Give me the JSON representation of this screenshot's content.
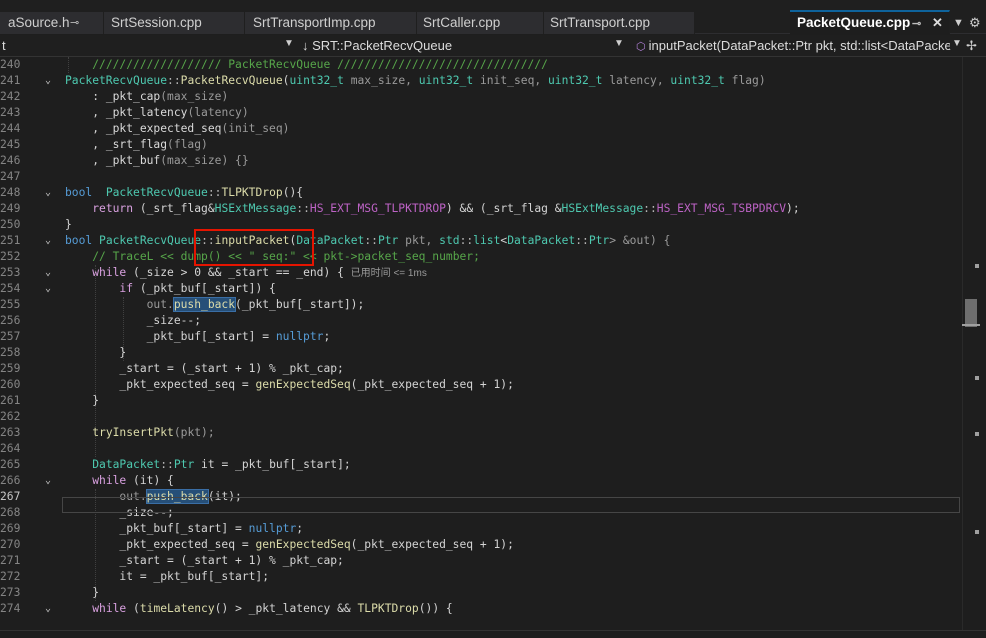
{
  "tabs": [
    {
      "label": "aSource.h",
      "pinned": true
    },
    {
      "label": "SrtSession.cpp"
    },
    {
      "label": "SrtTransportImp.cpp"
    },
    {
      "label": "SrtCaller.cpp"
    },
    {
      "label": "SrtTransport.cpp"
    },
    {
      "label": "PacketQueue.cpp",
      "active": true
    }
  ],
  "navbar": {
    "project": "t",
    "scope": "SRT::PacketRecvQueue",
    "member": "inputPacket(DataPacket::Ptr pkt, std::list<DataPacke"
  },
  "editor": {
    "current_line": "267",
    "inline_hint": "已用时间 <= 1ms"
  },
  "code_lines": [
    {
      "n": "240",
      "fold": "",
      "c": [
        {
          "t": "    ",
          "k": ""
        },
        {
          "t": "/////////////////// PacketRecvQueue ///////////////////////////////",
          "k": "cm"
        }
      ]
    },
    {
      "n": "241",
      "fold": "v",
      "c": [
        {
          "t": "PacketRecvQueue",
          "k": "tp"
        },
        {
          "t": "::",
          "k": "op"
        },
        {
          "t": "PacketRecvQueue",
          "k": "fn"
        },
        {
          "t": "(",
          "k": ""
        },
        {
          "t": "uint32_t",
          "k": "tp"
        },
        {
          "t": " max_size, ",
          "k": "pr"
        },
        {
          "t": "uint32_t",
          "k": "tp"
        },
        {
          "t": " init_seq, ",
          "k": "pr"
        },
        {
          "t": "uint32_t",
          "k": "tp"
        },
        {
          "t": " latency, ",
          "k": "pr"
        },
        {
          "t": "uint32_t",
          "k": "tp"
        },
        {
          "t": " flag)",
          "k": "pr"
        }
      ]
    },
    {
      "n": "242",
      "fold": "",
      "c": [
        {
          "t": "    : ",
          "k": ""
        },
        {
          "t": "_pkt_cap",
          "k": "var"
        },
        {
          "t": "(max_size)",
          "k": "pr"
        }
      ]
    },
    {
      "n": "243",
      "fold": "",
      "c": [
        {
          "t": "    , ",
          "k": ""
        },
        {
          "t": "_pkt_latency",
          "k": "var"
        },
        {
          "t": "(latency)",
          "k": "pr"
        }
      ]
    },
    {
      "n": "244",
      "fold": "",
      "c": [
        {
          "t": "    , ",
          "k": ""
        },
        {
          "t": "_pkt_expected_seq",
          "k": "var"
        },
        {
          "t": "(init_seq)",
          "k": "pr"
        }
      ]
    },
    {
      "n": "245",
      "fold": "",
      "c": [
        {
          "t": "    , ",
          "k": ""
        },
        {
          "t": "_srt_flag",
          "k": "var"
        },
        {
          "t": "(flag)",
          "k": "pr"
        }
      ]
    },
    {
      "n": "246",
      "fold": "",
      "c": [
        {
          "t": "    , ",
          "k": ""
        },
        {
          "t": "_pkt_buf",
          "k": "var"
        },
        {
          "t": "(max_size) {}",
          "k": "pr"
        }
      ]
    },
    {
      "n": "247",
      "fold": "",
      "c": []
    },
    {
      "n": "248",
      "fold": "v",
      "c": [
        {
          "t": "bool",
          "k": "kw"
        },
        {
          "t": "  ",
          "k": ""
        },
        {
          "t": "PacketRecvQueue",
          "k": "tp"
        },
        {
          "t": "::",
          "k": "op"
        },
        {
          "t": "TLPKTDrop",
          "k": "fn"
        },
        {
          "t": "(){",
          "k": ""
        }
      ]
    },
    {
      "n": "249",
      "fold": "",
      "c": [
        {
          "t": "    ",
          "k": ""
        },
        {
          "t": "return",
          "k": "ctl"
        },
        {
          "t": " (_srt_flag&",
          "k": ""
        },
        {
          "t": "HSExtMessage",
          "k": "tp"
        },
        {
          "t": "::",
          "k": "op"
        },
        {
          "t": "HS_EXT_MSG_TLPKTDROP",
          "k": "mac"
        },
        {
          "t": ") && (_srt_flag &",
          "k": ""
        },
        {
          "t": "HSExtMessage",
          "k": "tp"
        },
        {
          "t": "::",
          "k": "op"
        },
        {
          "t": "HS_EXT_MSG_TSBPDRCV",
          "k": "mac"
        },
        {
          "t": ");",
          "k": ""
        }
      ]
    },
    {
      "n": "250",
      "fold": "",
      "c": [
        {
          "t": "}",
          "k": ""
        }
      ]
    },
    {
      "n": "251",
      "fold": "v",
      "c": [
        {
          "t": "bool",
          "k": "kw"
        },
        {
          "t": " ",
          "k": ""
        },
        {
          "t": "PacketRecvQueue",
          "k": "tp"
        },
        {
          "t": "::",
          "k": "op"
        },
        {
          "t": "inputPacket",
          "k": "fn"
        },
        {
          "t": "(",
          "k": ""
        },
        {
          "t": "DataPacket",
          "k": "tp"
        },
        {
          "t": "::",
          "k": "op"
        },
        {
          "t": "Ptr",
          "k": "tp"
        },
        {
          "t": " pkt, ",
          "k": "pr"
        },
        {
          "t": "std",
          "k": "tp"
        },
        {
          "t": "::",
          "k": "op"
        },
        {
          "t": "list",
          "k": "tp"
        },
        {
          "t": "<",
          "k": ""
        },
        {
          "t": "DataPacket",
          "k": "tp"
        },
        {
          "t": "::",
          "k": "op"
        },
        {
          "t": "Ptr",
          "k": "tp"
        },
        {
          "t": "> &out) {",
          "k": "pr"
        }
      ]
    },
    {
      "n": "252",
      "fold": "",
      "c": [
        {
          "t": "    ",
          "k": ""
        },
        {
          "t": "// TraceL << dump() << \" seq:\" << pkt->packet_seq_number;",
          "k": "cm"
        }
      ]
    },
    {
      "n": "253",
      "fold": "v",
      "c": [
        {
          "t": "    ",
          "k": ""
        },
        {
          "t": "while",
          "k": "ctl"
        },
        {
          "t": " (_size > 0 && _start == _end) { ",
          "k": ""
        },
        {
          "t": "HINT",
          "k": "hint"
        }
      ]
    },
    {
      "n": "254",
      "fold": "v",
      "c": [
        {
          "t": "        ",
          "k": ""
        },
        {
          "t": "if",
          "k": "ctl"
        },
        {
          "t": " (_pkt_buf[_start]) {",
          "k": ""
        }
      ]
    },
    {
      "n": "255",
      "fold": "",
      "c": [
        {
          "t": "            out.",
          "k": "pr"
        },
        {
          "t": "push_back",
          "k": "hl"
        },
        {
          "t": "(_pkt_buf[_start]);",
          "k": ""
        }
      ]
    },
    {
      "n": "256",
      "fold": "",
      "c": [
        {
          "t": "            _size--;",
          "k": ""
        }
      ]
    },
    {
      "n": "257",
      "fold": "",
      "c": [
        {
          "t": "            _pkt_buf[_start] = ",
          "k": ""
        },
        {
          "t": "nullptr",
          "k": "kw"
        },
        {
          "t": ";",
          "k": ""
        }
      ]
    },
    {
      "n": "258",
      "fold": "",
      "c": [
        {
          "t": "        }",
          "k": ""
        }
      ]
    },
    {
      "n": "259",
      "fold": "",
      "c": [
        {
          "t": "        _start = (_start + 1) % _pkt_cap;",
          "k": ""
        }
      ]
    },
    {
      "n": "260",
      "fold": "",
      "c": [
        {
          "t": "        _pkt_expected_seq = ",
          "k": ""
        },
        {
          "t": "genExpectedSeq",
          "k": "fn"
        },
        {
          "t": "(_pkt_expected_seq + 1);",
          "k": ""
        }
      ]
    },
    {
      "n": "261",
      "fold": "",
      "c": [
        {
          "t": "    }",
          "k": ""
        }
      ]
    },
    {
      "n": "262",
      "fold": "",
      "c": []
    },
    {
      "n": "263",
      "fold": "",
      "c": [
        {
          "t": "    ",
          "k": ""
        },
        {
          "t": "tryInsertPkt",
          "k": "fn"
        },
        {
          "t": "(pkt);",
          "k": "pr"
        }
      ]
    },
    {
      "n": "264",
      "fold": "",
      "c": []
    },
    {
      "n": "265",
      "fold": "",
      "c": [
        {
          "t": "    ",
          "k": ""
        },
        {
          "t": "DataPacket",
          "k": "tp"
        },
        {
          "t": "::",
          "k": "op"
        },
        {
          "t": "Ptr",
          "k": "tp"
        },
        {
          "t": " it = _pkt_buf[_start];",
          "k": ""
        }
      ]
    },
    {
      "n": "266",
      "fold": "v",
      "c": [
        {
          "t": "    ",
          "k": ""
        },
        {
          "t": "while",
          "k": "ctl"
        },
        {
          "t": " (it) {",
          "k": ""
        }
      ]
    },
    {
      "n": "267",
      "fold": "",
      "c": [
        {
          "t": "        out.",
          "k": "pr"
        },
        {
          "t": "push_back",
          "k": "hl"
        },
        {
          "t": "(it);",
          "k": ""
        }
      ]
    },
    {
      "n": "268",
      "fold": "",
      "c": [
        {
          "t": "        _size--;",
          "k": ""
        }
      ]
    },
    {
      "n": "269",
      "fold": "",
      "c": [
        {
          "t": "        _pkt_buf[_start] = ",
          "k": ""
        },
        {
          "t": "nullptr",
          "k": "kw"
        },
        {
          "t": ";",
          "k": ""
        }
      ]
    },
    {
      "n": "270",
      "fold": "",
      "c": [
        {
          "t": "        _pkt_expected_seq = ",
          "k": ""
        },
        {
          "t": "genExpectedSeq",
          "k": "fn"
        },
        {
          "t": "(_pkt_expected_seq + 1);",
          "k": ""
        }
      ]
    },
    {
      "n": "271",
      "fold": "",
      "c": [
        {
          "t": "        _start = (_start + 1) % _pkt_cap;",
          "k": ""
        }
      ]
    },
    {
      "n": "272",
      "fold": "",
      "c": [
        {
          "t": "        it = _pkt_buf[_start];",
          "k": ""
        }
      ]
    },
    {
      "n": "273",
      "fold": "",
      "c": [
        {
          "t": "    }",
          "k": ""
        }
      ]
    },
    {
      "n": "274",
      "fold": "v",
      "c": [
        {
          "t": "    ",
          "k": ""
        },
        {
          "t": "while",
          "k": "ctl"
        },
        {
          "t": " (",
          "k": ""
        },
        {
          "t": "timeLatency",
          "k": "fn"
        },
        {
          "t": "() > _pkt_latency && ",
          "k": ""
        },
        {
          "t": "TLPKTDrop",
          "k": "fn"
        },
        {
          "t": "()) {",
          "k": ""
        }
      ]
    }
  ]
}
